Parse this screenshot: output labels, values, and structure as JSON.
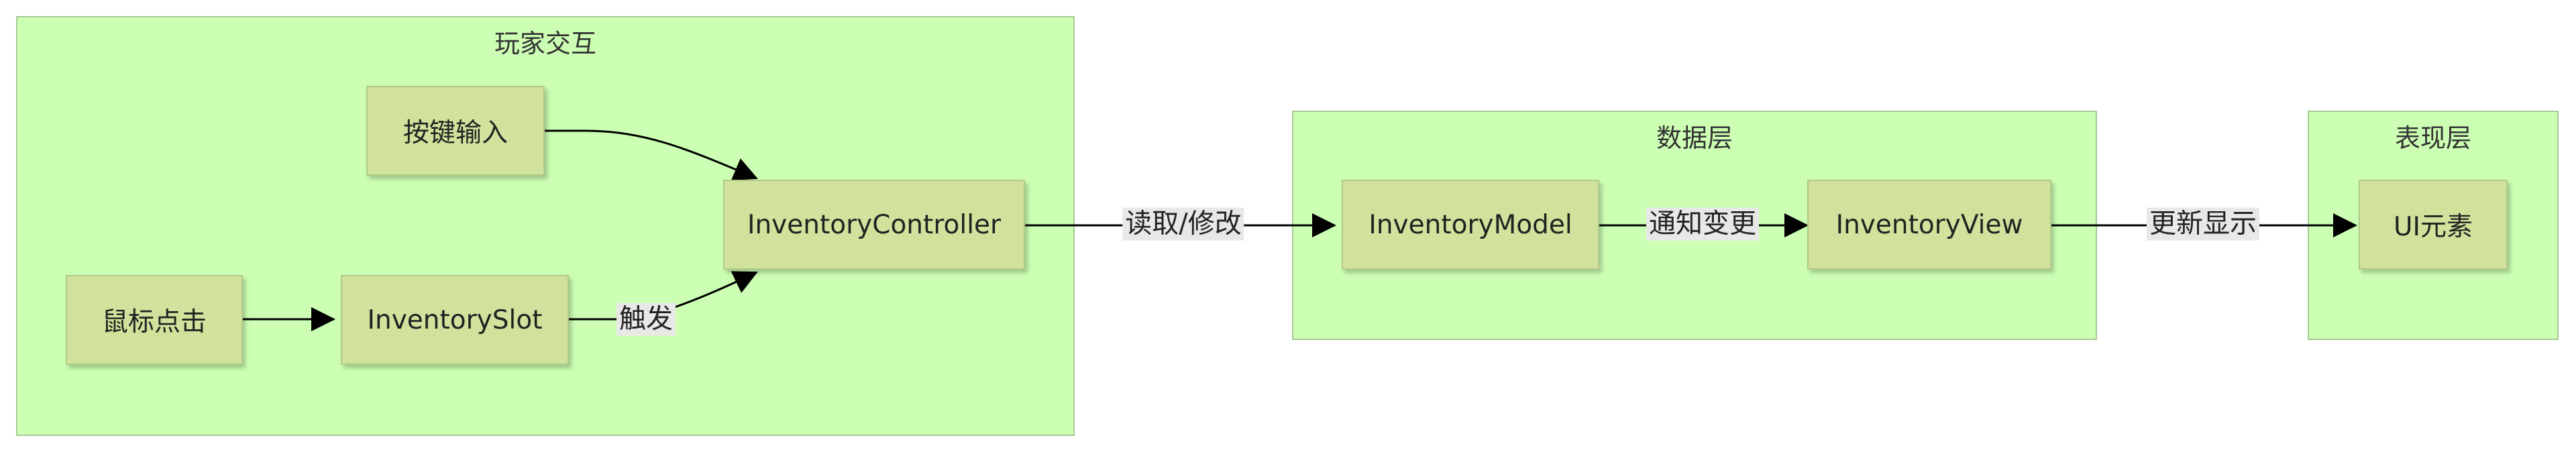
{
  "clusters": {
    "player": {
      "title": "玩家交互"
    },
    "data": {
      "title": "数据层"
    },
    "view": {
      "title": "表现层"
    }
  },
  "nodes": {
    "key_input": "按键输入",
    "mouse_click": "鼠标点击",
    "inventory_slot": "InventorySlot",
    "inventory_controller": "InventoryController",
    "inventory_model": "InventoryModel",
    "inventory_view": "InventoryView",
    "ui_element": "UI元素"
  },
  "edges": {
    "trigger": "触发",
    "read_modify": "读取/修改",
    "notify_change": "通知变更",
    "update_display": "更新显示"
  },
  "colors": {
    "cluster_fill": "#ccffb3",
    "cluster_border": "#a7c994",
    "node_fill": "#d0e29b",
    "node_border": "#b3c986",
    "edge": "#000000",
    "label_background": "#e8e8e8"
  }
}
